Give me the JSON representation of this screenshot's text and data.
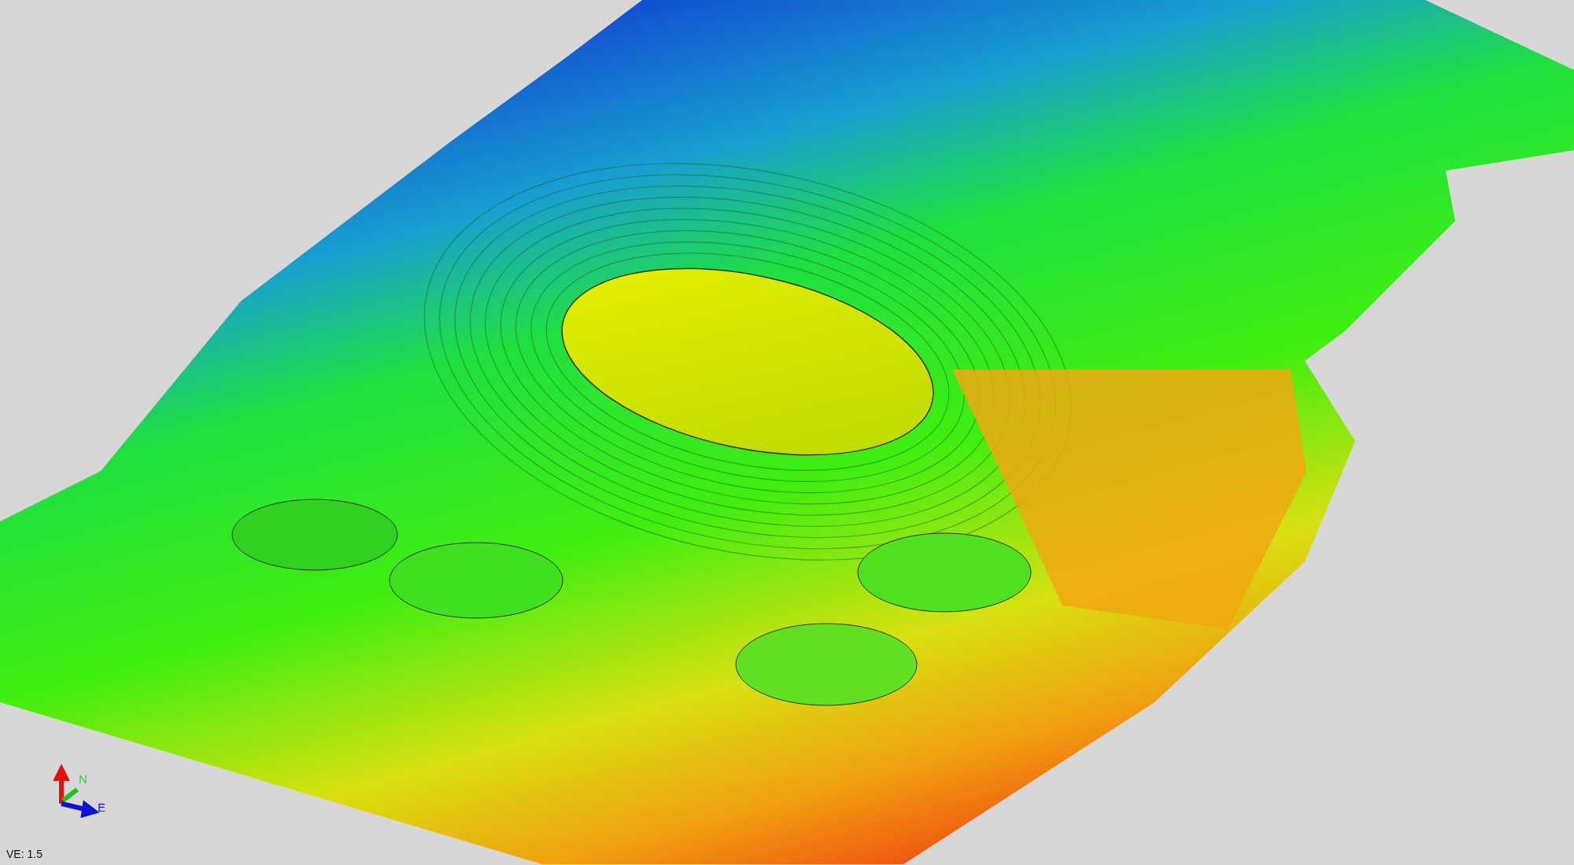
{
  "viewport": {
    "axis_labels": [
      {
        "kind": "north",
        "label": "N"
      },
      {
        "kind": "east",
        "label": "E"
      }
    ],
    "vertical_exaggeration": "VE: 1.5"
  }
}
